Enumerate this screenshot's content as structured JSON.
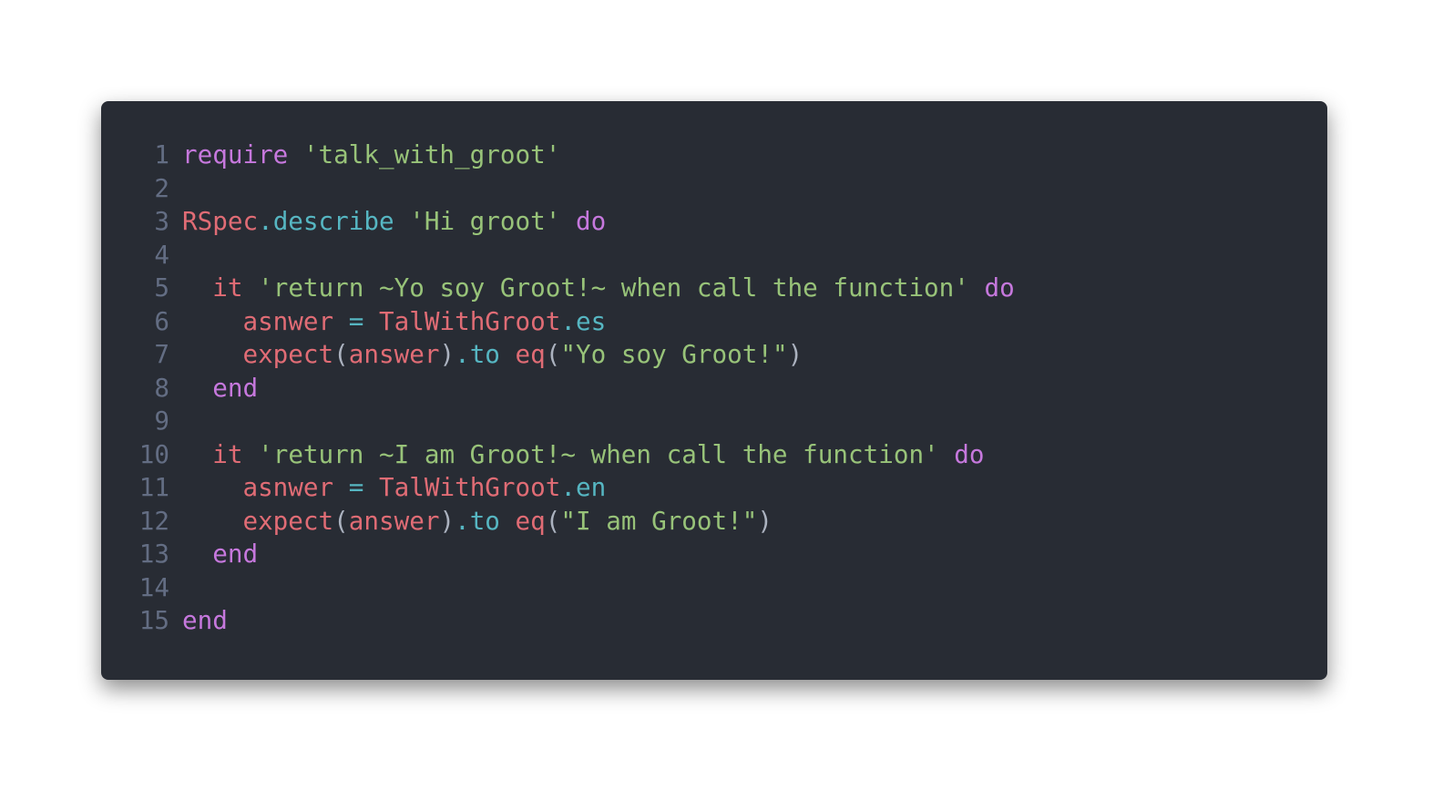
{
  "editor": {
    "theme": {
      "background": "#282c34",
      "line_number": "#636d83",
      "keyword": "#c678dd",
      "string": "#98c379",
      "constant": "#e06c75",
      "method": "#56b6c2",
      "punctuation": "#abb2bf"
    },
    "lines": [
      {
        "number": "1",
        "tokens": [
          {
            "t": "require",
            "k": "keyword"
          },
          {
            "t": " ",
            "k": "plain"
          },
          {
            "t": "'talk_with_groot'",
            "k": "string"
          }
        ]
      },
      {
        "number": "2",
        "tokens": []
      },
      {
        "number": "3",
        "tokens": [
          {
            "t": "RSpec",
            "k": "const"
          },
          {
            "t": ".describe",
            "k": "method"
          },
          {
            "t": " ",
            "k": "plain"
          },
          {
            "t": "'Hi groot'",
            "k": "string"
          },
          {
            "t": " ",
            "k": "plain"
          },
          {
            "t": "do",
            "k": "keyword"
          }
        ]
      },
      {
        "number": "4",
        "tokens": []
      },
      {
        "number": "5",
        "tokens": [
          {
            "t": "  ",
            "k": "plain"
          },
          {
            "t": "it",
            "k": "ident"
          },
          {
            "t": " ",
            "k": "plain"
          },
          {
            "t": "'return ~Yo soy Groot!~ when call the function'",
            "k": "string"
          },
          {
            "t": " ",
            "k": "plain"
          },
          {
            "t": "do",
            "k": "keyword"
          }
        ]
      },
      {
        "number": "6",
        "tokens": [
          {
            "t": "    ",
            "k": "plain"
          },
          {
            "t": "asnwer",
            "k": "ident"
          },
          {
            "t": " ",
            "k": "plain"
          },
          {
            "t": "=",
            "k": "op"
          },
          {
            "t": " ",
            "k": "plain"
          },
          {
            "t": "TalWithGroot",
            "k": "const"
          },
          {
            "t": ".es",
            "k": "method"
          }
        ]
      },
      {
        "number": "7",
        "tokens": [
          {
            "t": "    ",
            "k": "plain"
          },
          {
            "t": "expect",
            "k": "ident"
          },
          {
            "t": "(",
            "k": "punct"
          },
          {
            "t": "answer",
            "k": "ident"
          },
          {
            "t": ")",
            "k": "punct"
          },
          {
            "t": ".to",
            "k": "method"
          },
          {
            "t": " ",
            "k": "plain"
          },
          {
            "t": "eq",
            "k": "ident"
          },
          {
            "t": "(",
            "k": "punct"
          },
          {
            "t": "\"Yo soy Groot!\"",
            "k": "string"
          },
          {
            "t": ")",
            "k": "punct"
          }
        ]
      },
      {
        "number": "8",
        "tokens": [
          {
            "t": "  ",
            "k": "plain"
          },
          {
            "t": "end",
            "k": "keyword"
          }
        ]
      },
      {
        "number": "9",
        "tokens": []
      },
      {
        "number": "10",
        "tokens": [
          {
            "t": "  ",
            "k": "plain"
          },
          {
            "t": "it",
            "k": "ident"
          },
          {
            "t": " ",
            "k": "plain"
          },
          {
            "t": "'return ~I am Groot!~ when call the function'",
            "k": "string"
          },
          {
            "t": " ",
            "k": "plain"
          },
          {
            "t": "do",
            "k": "keyword"
          }
        ]
      },
      {
        "number": "11",
        "tokens": [
          {
            "t": "    ",
            "k": "plain"
          },
          {
            "t": "asnwer",
            "k": "ident"
          },
          {
            "t": " ",
            "k": "plain"
          },
          {
            "t": "=",
            "k": "op"
          },
          {
            "t": " ",
            "k": "plain"
          },
          {
            "t": "TalWithGroot",
            "k": "const"
          },
          {
            "t": ".en",
            "k": "method"
          }
        ]
      },
      {
        "number": "12",
        "tokens": [
          {
            "t": "    ",
            "k": "plain"
          },
          {
            "t": "expect",
            "k": "ident"
          },
          {
            "t": "(",
            "k": "punct"
          },
          {
            "t": "answer",
            "k": "ident"
          },
          {
            "t": ")",
            "k": "punct"
          },
          {
            "t": ".to",
            "k": "method"
          },
          {
            "t": " ",
            "k": "plain"
          },
          {
            "t": "eq",
            "k": "ident"
          },
          {
            "t": "(",
            "k": "punct"
          },
          {
            "t": "\"I am Groot!\"",
            "k": "string"
          },
          {
            "t": ")",
            "k": "punct"
          }
        ]
      },
      {
        "number": "13",
        "tokens": [
          {
            "t": "  ",
            "k": "plain"
          },
          {
            "t": "end",
            "k": "keyword"
          }
        ]
      },
      {
        "number": "14",
        "tokens": []
      },
      {
        "number": "15",
        "tokens": [
          {
            "t": "end",
            "k": "keyword"
          }
        ]
      }
    ]
  }
}
